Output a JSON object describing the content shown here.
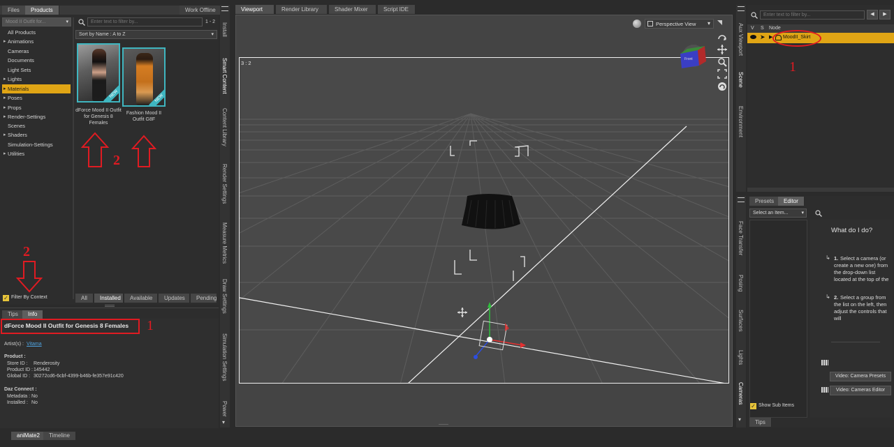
{
  "left_panel": {
    "tabs": [
      "Files",
      "Products"
    ],
    "work_offline": "Work Offline",
    "dropdown_value": "Mood II Outfit for...",
    "filter_placeholder": "Enter text to filter by...",
    "page_count": "1 - 2",
    "sort_label": "Sort by Name : A to Z",
    "categories": [
      {
        "label": "All Products",
        "expand": false
      },
      {
        "label": "Animations",
        "expand": true
      },
      {
        "label": "Cameras",
        "expand": false
      },
      {
        "label": "Documents",
        "expand": false
      },
      {
        "label": "Light Sets",
        "expand": false
      },
      {
        "label": "Lights",
        "expand": true
      },
      {
        "label": "Materials",
        "expand": true,
        "selected": true
      },
      {
        "label": "Poses",
        "expand": true
      },
      {
        "label": "Props",
        "expand": true
      },
      {
        "label": "Render-Settings",
        "expand": true
      },
      {
        "label": "Scenes",
        "expand": false
      },
      {
        "label": "Shaders",
        "expand": true
      },
      {
        "label": "Simulation-Settings",
        "expand": false
      },
      {
        "label": "Utilities",
        "expand": true
      }
    ],
    "products": [
      {
        "title": "dForce Mood II Outfit for Genesis 8 Females",
        "badge": "NEW"
      },
      {
        "title": "Fashion Mood II Outfit G8F",
        "badge": "NEW"
      }
    ],
    "bottom_tabs": [
      "All",
      "Installed",
      "Available",
      "Updates",
      "Pending"
    ],
    "filter_by_context": "Filter By Context"
  },
  "info_panel": {
    "tabs": [
      "Tips",
      "Info"
    ],
    "product_title": "dForce Mood II Outfit for Genesis 8 Females",
    "artists_label": "Artist(s) :",
    "artist_value": "Vitama",
    "product_heading": "Product :",
    "store_id_label": "Store ID :",
    "store_id": "Renderosity",
    "product_id_label": "Product ID :",
    "product_id": "145442",
    "global_id_label": "Global ID :",
    "global_id": "30272cd6-6cbf-4399-b46b-fe357e91c420",
    "daz_connect_heading": "Daz Connect :",
    "metadata_label": "Metadata :",
    "metadata": "No",
    "installed_label": "Installed :",
    "installed": "No"
  },
  "left_side_tabs": [
    "Install",
    "Smart Content",
    "Content Library",
    "Render Settings",
    "Measure Metrics",
    "Draw Settings",
    "Simulation Settings",
    "Power"
  ],
  "viewport": {
    "tabs": [
      "Viewport",
      "Render Library",
      "Shader Mixer",
      "Script IDE"
    ],
    "view_mode": "Perspective View",
    "aspect": "3 : 2",
    "cube_label": "Front"
  },
  "right_side_tabs_top": [
    "Aux Viewport",
    "Scene",
    "Environment"
  ],
  "right_side_tabs_bottom": [
    "Face Transfer",
    "Posing",
    "Surfaces",
    "Lights",
    "Cameras"
  ],
  "scene_panel": {
    "filter_placeholder": "Enter text to filter by...",
    "col_v": "V",
    "col_s": "S",
    "col_node": "Node",
    "node": "MoodII_Skirt"
  },
  "editor_panel": {
    "tabs": [
      "Presets",
      "Editor"
    ],
    "select_item": "Select an Item...",
    "what_title": "What do I do?",
    "step1_num": "1.",
    "step1": "Select a camera (or create a new one) from the drop-down list located at the top of the",
    "step2_num": "2.",
    "step2": "Select a group from the list on the left, then adjust the controls that will",
    "video1": "Video: Camera Presets",
    "video2": "Video: Cameras Editor",
    "show_sub_items": "Show Sub Items",
    "bottom_tab": "Tips"
  },
  "bottom_tabs": [
    "aniMate2",
    "Timeline"
  ],
  "annotations": {
    "one": "1",
    "two": "2"
  },
  "colors": {
    "accent": "#e0a515",
    "annotation": "#e01b22",
    "link": "#4fa3e0"
  }
}
